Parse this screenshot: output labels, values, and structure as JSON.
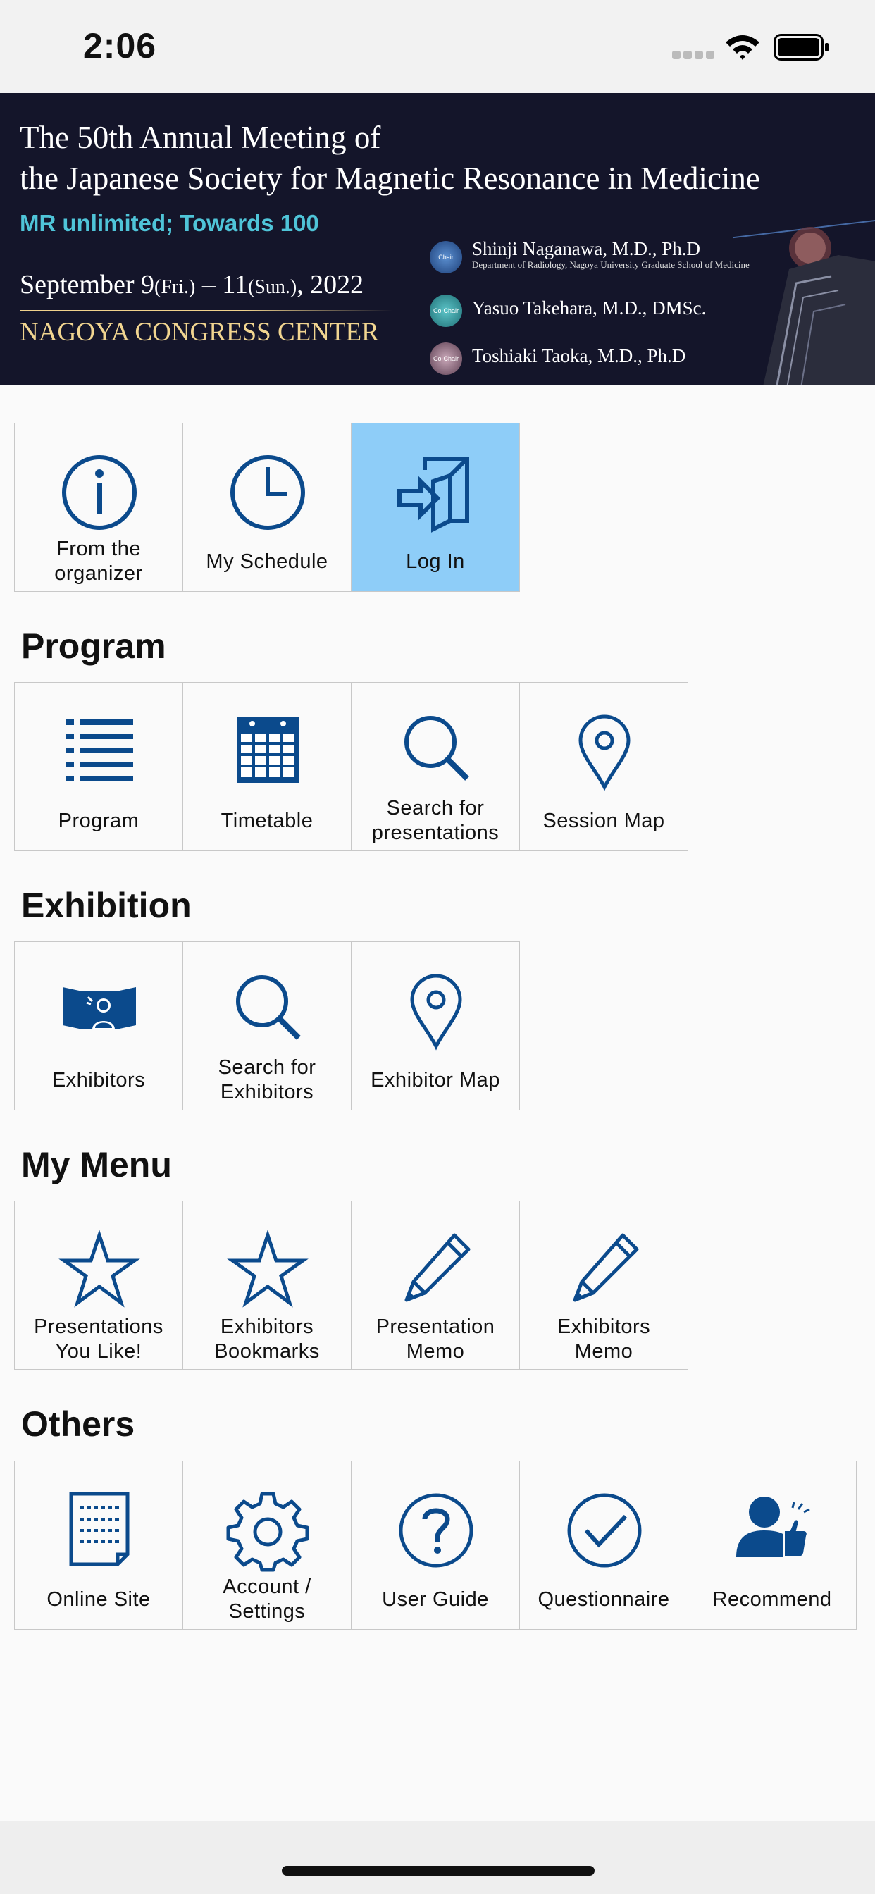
{
  "status_bar": {
    "time": "2:06"
  },
  "banner": {
    "title_line1": "The 50th Annual Meeting of",
    "title_line2": "the Japanese Society for Magnetic Resonance in Medicine",
    "subtitle": "MR unlimited; Towards 100",
    "dates_main": "September 9",
    "dates_fri": "(Fri.)",
    "dates_mid": " – 11",
    "dates_sun": "(Sun.)",
    "dates_year": ", 2022",
    "venue": "NAGOYA CONGRESS CENTER",
    "chairs": [
      {
        "badge": "Chair",
        "name": "Shinji Naganawa, M.D., Ph.D",
        "dept": "Department of Radiology, Nagoya University Graduate School of Medicine",
        "color": "#2a5f9e"
      },
      {
        "badge": "Co-Chair",
        "name": "Yasuo Takehara, M.D., DMSc.",
        "dept": "",
        "color": "#2a8c92"
      },
      {
        "badge": "Co-Chair",
        "name": "Toshiaki Taoka, M.D., Ph.D",
        "dept": "",
        "color": "#8c6a7e"
      }
    ]
  },
  "top_menu": [
    {
      "label": "From the\norganizer",
      "icon": "info-icon",
      "active": false
    },
    {
      "label": "My Schedule",
      "icon": "clock-icon",
      "active": false
    },
    {
      "label": "Log In",
      "icon": "login-icon",
      "active": true
    }
  ],
  "sections": {
    "program": {
      "title": "Program",
      "items": [
        {
          "label": "Program",
          "icon": "list-icon"
        },
        {
          "label": "Timetable",
          "icon": "calendar-icon"
        },
        {
          "label": "Search for\npresentations",
          "icon": "search-icon"
        },
        {
          "label": "Session Map",
          "icon": "map-pin-icon"
        }
      ]
    },
    "exhibition": {
      "title": "Exhibition",
      "items": [
        {
          "label": "Exhibitors",
          "icon": "exhibitor-booth-icon"
        },
        {
          "label": "Search for\nExhibitors",
          "icon": "search-icon"
        },
        {
          "label": "Exhibitor Map",
          "icon": "map-pin-icon"
        }
      ]
    },
    "my_menu": {
      "title": "My Menu",
      "items": [
        {
          "label": "Presentations\nYou Like!",
          "icon": "star-icon"
        },
        {
          "label": "Exhibitors\nBookmarks",
          "icon": "star-icon"
        },
        {
          "label": "Presentation\nMemo",
          "icon": "pencil-icon"
        },
        {
          "label": "Exhibitors\nMemo",
          "icon": "pencil-icon"
        }
      ]
    },
    "others": {
      "title": "Others",
      "items": [
        {
          "label": "Online Site",
          "icon": "document-icon"
        },
        {
          "label": "Account /\nSettings",
          "icon": "gear-icon"
        },
        {
          "label": "User Guide",
          "icon": "help-icon"
        },
        {
          "label": "Questionnaire",
          "icon": "check-circle-icon"
        },
        {
          "label": "Recommend",
          "icon": "thumbs-up-user-icon"
        }
      ]
    }
  },
  "colors": {
    "icon": "#0b4a8c",
    "active_tile": "#8ecdf8",
    "banner_bg": "#14152a"
  }
}
